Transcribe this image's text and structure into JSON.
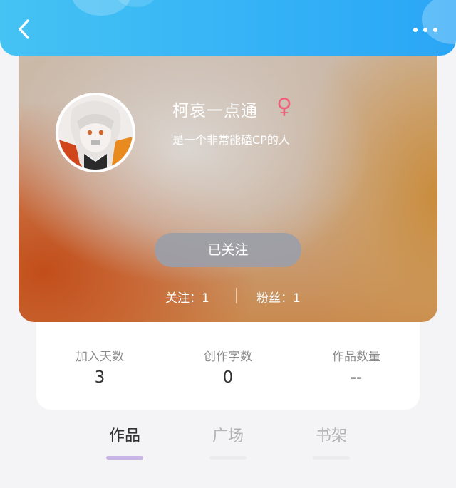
{
  "colors": {
    "header_start": "#45c3f3",
    "header_end": "#2aa6f6",
    "gender": "#f0607d",
    "follow_button": "#9b9ea8",
    "tab_indicator_active": "#c9b4e6"
  },
  "header": {
    "back_icon": "chevron-left-icon",
    "more_icon": "more-horizontal-icon"
  },
  "profile": {
    "name": "柯哀一点通",
    "gender_symbol": "♀",
    "bio": "是一个非常能磕CP的人",
    "follow_button_label": "已关注",
    "following_text": "关注：1",
    "fans_text": "粉丝：1"
  },
  "stats": [
    {
      "label": "加入天数",
      "value": "3"
    },
    {
      "label": "创作字数",
      "value": "0"
    },
    {
      "label": "作品数量",
      "value": "--"
    }
  ],
  "tabs": [
    {
      "label": "作品",
      "active": true
    },
    {
      "label": "广场",
      "active": false
    },
    {
      "label": "书架",
      "active": false
    }
  ]
}
